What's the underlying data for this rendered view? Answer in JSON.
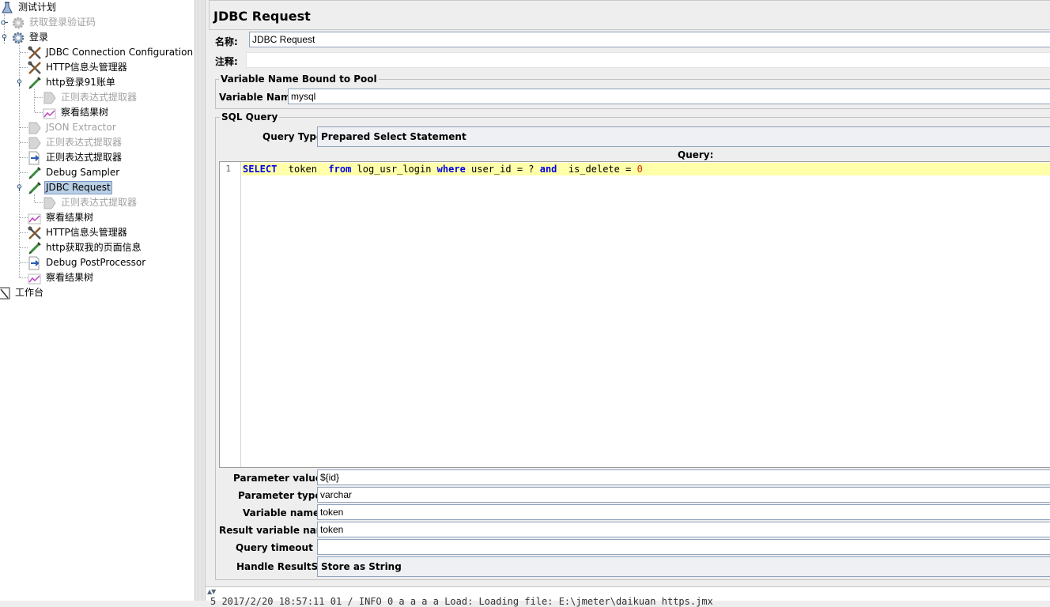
{
  "tree": {
    "nodes": [
      {
        "label": "测试计划",
        "icon": "flask-icon",
        "disabled": false,
        "selected": false
      },
      {
        "label": "获取登录验证码",
        "icon": "gear-icon",
        "disabled": true,
        "selected": false
      },
      {
        "label": "登录",
        "icon": "gear-icon",
        "disabled": false,
        "selected": false
      },
      {
        "label": "JDBC Connection Configuration",
        "icon": "wrench-icon",
        "disabled": false,
        "selected": false
      },
      {
        "label": "HTTP信息头管理器",
        "icon": "wrench-icon",
        "disabled": false,
        "selected": false
      },
      {
        "label": "http登录91账单",
        "icon": "pipette-icon",
        "disabled": false,
        "selected": false
      },
      {
        "label": "正则表达式提取器",
        "icon": "postprocessor-icon",
        "disabled": true,
        "selected": false
      },
      {
        "label": "察看结果树",
        "icon": "chart-icon",
        "disabled": false,
        "selected": false
      },
      {
        "label": "JSON Extractor",
        "icon": "postprocessor-icon",
        "disabled": true,
        "selected": false
      },
      {
        "label": "正则表达式提取器",
        "icon": "postprocessor-icon",
        "disabled": true,
        "selected": false
      },
      {
        "label": "正则表达式提取器",
        "icon": "postprocessor-arrow-icon",
        "disabled": false,
        "selected": false
      },
      {
        "label": "Debug Sampler",
        "icon": "pipette-icon",
        "disabled": false,
        "selected": false
      },
      {
        "label": "JDBC Request",
        "icon": "pipette-icon",
        "disabled": false,
        "selected": true
      },
      {
        "label": "正则表达式提取器",
        "icon": "postprocessor-icon",
        "disabled": true,
        "selected": false
      },
      {
        "label": "察看结果树",
        "icon": "chart-icon",
        "disabled": false,
        "selected": false
      },
      {
        "label": "HTTP信息头管理器",
        "icon": "wrench-icon",
        "disabled": false,
        "selected": false
      },
      {
        "label": "http获取我的页面信息",
        "icon": "pipette-icon",
        "disabled": false,
        "selected": false
      },
      {
        "label": "Debug PostProcessor",
        "icon": "postprocessor-arrow-icon",
        "disabled": false,
        "selected": false
      },
      {
        "label": "察看结果树",
        "icon": "chart-icon",
        "disabled": false,
        "selected": false
      },
      {
        "label": "工作台",
        "icon": "workbench-icon",
        "disabled": false,
        "selected": false
      }
    ]
  },
  "panel": {
    "title": "JDBC Request",
    "name_label": "名称:",
    "name_value": "JDBC Request",
    "comment_label": "注释:",
    "comment_value": "",
    "pool_group_title": "Variable Name Bound to Pool",
    "variable_name_label": "Variable Name:",
    "variable_name_value": "mysql",
    "sql_group_title": "SQL Query",
    "query_type_label": "Query Type:",
    "query_type_value": "Prepared Select Statement",
    "query_header": "Query:",
    "line_number": "1",
    "sql": {
      "t1": "SELECT",
      "t2": "  token  ",
      "t3": "from",
      "t4": " log_usr_login ",
      "t5": "where",
      "t6": " user_id = ? ",
      "t7": "and",
      "t8": "  is_delete = ",
      "t9": "0"
    },
    "parameter_values_label": "Parameter values:",
    "parameter_values_value": "${id}",
    "parameter_types_label": "Parameter types:",
    "parameter_types_value": "varchar",
    "variable_names_label": "Variable names:",
    "variable_names_value": "token",
    "result_variable_label": "Result variable name:",
    "result_variable_value": "token",
    "query_timeout_label": "Query timeout (s):",
    "query_timeout_value": "",
    "handle_resultset_label": "Handle ResultSet:",
    "handle_resultset_value": "Store as String"
  },
  "log": {
    "text": "5 2017/2/20 18:57:11 01 / INFO 0 a a a a Load: Loading file: E:\\jmeter\\daikuan https.jmx"
  }
}
